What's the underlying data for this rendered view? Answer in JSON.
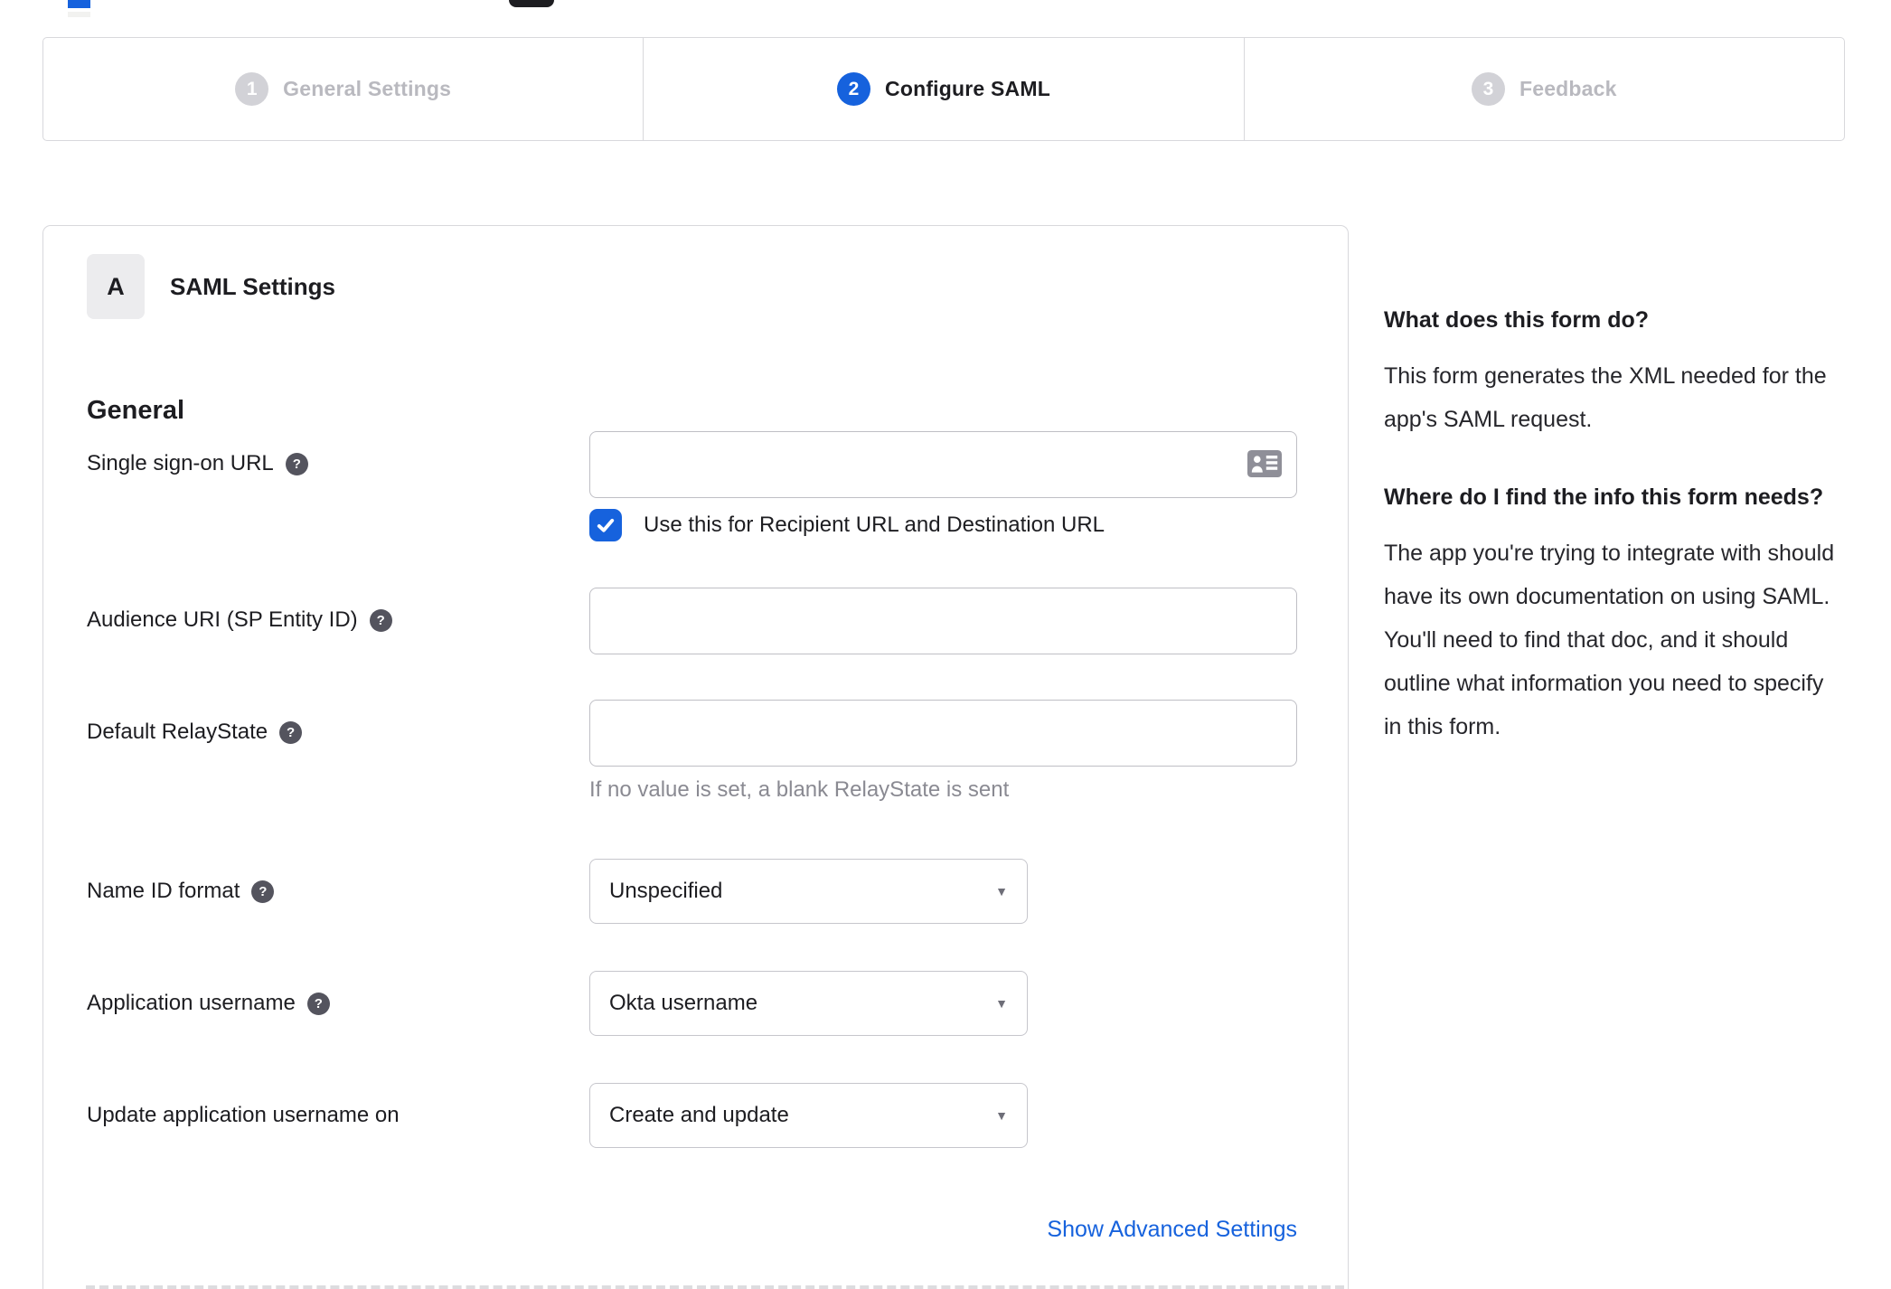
{
  "stepper": {
    "steps": [
      {
        "number": "1",
        "label": "General Settings",
        "state": "inactive"
      },
      {
        "number": "2",
        "label": "Configure SAML",
        "state": "active"
      },
      {
        "number": "3",
        "label": "Feedback",
        "state": "inactive"
      }
    ]
  },
  "form": {
    "badge": "A",
    "title": "SAML Settings",
    "section": "General",
    "fields": [
      {
        "label": "Single sign-on URL",
        "type": "text",
        "value": "",
        "trailing_icon": "contact-card-icon",
        "checkbox": {
          "checked": true,
          "label": "Use this for Recipient URL and Destination URL"
        }
      },
      {
        "label": "Audience URI (SP Entity ID)",
        "type": "text",
        "value": ""
      },
      {
        "label": "Default RelayState",
        "type": "text",
        "value": "",
        "helper": "If no value is set, a blank RelayState is sent"
      },
      {
        "label": "Name ID format",
        "type": "select",
        "value": "Unspecified"
      },
      {
        "label": "Application username",
        "type": "select",
        "value": "Okta username"
      },
      {
        "label": "Update application username on",
        "type": "select",
        "value": "Create and update"
      }
    ],
    "advanced_link": "Show Advanced Settings"
  },
  "sidebar": {
    "blocks": [
      {
        "heading": "What does this form do?",
        "body": "This form generates the XML needed for the app's SAML request."
      },
      {
        "heading": "Where do I find the info this form needs?",
        "body": "The app you're trying to integrate with should have its own documentation on using SAML. You'll need to find that doc, and it should outline what information you need to specify in this form."
      }
    ]
  },
  "colors": {
    "accent_blue": "#1662dd",
    "text_dark": "#1d1d21",
    "muted_gray": "#8a8a92",
    "border_gray": "#d8d8dc",
    "inactive_gray": "#b9b9bf",
    "help_icon_gray": "#54545e"
  }
}
